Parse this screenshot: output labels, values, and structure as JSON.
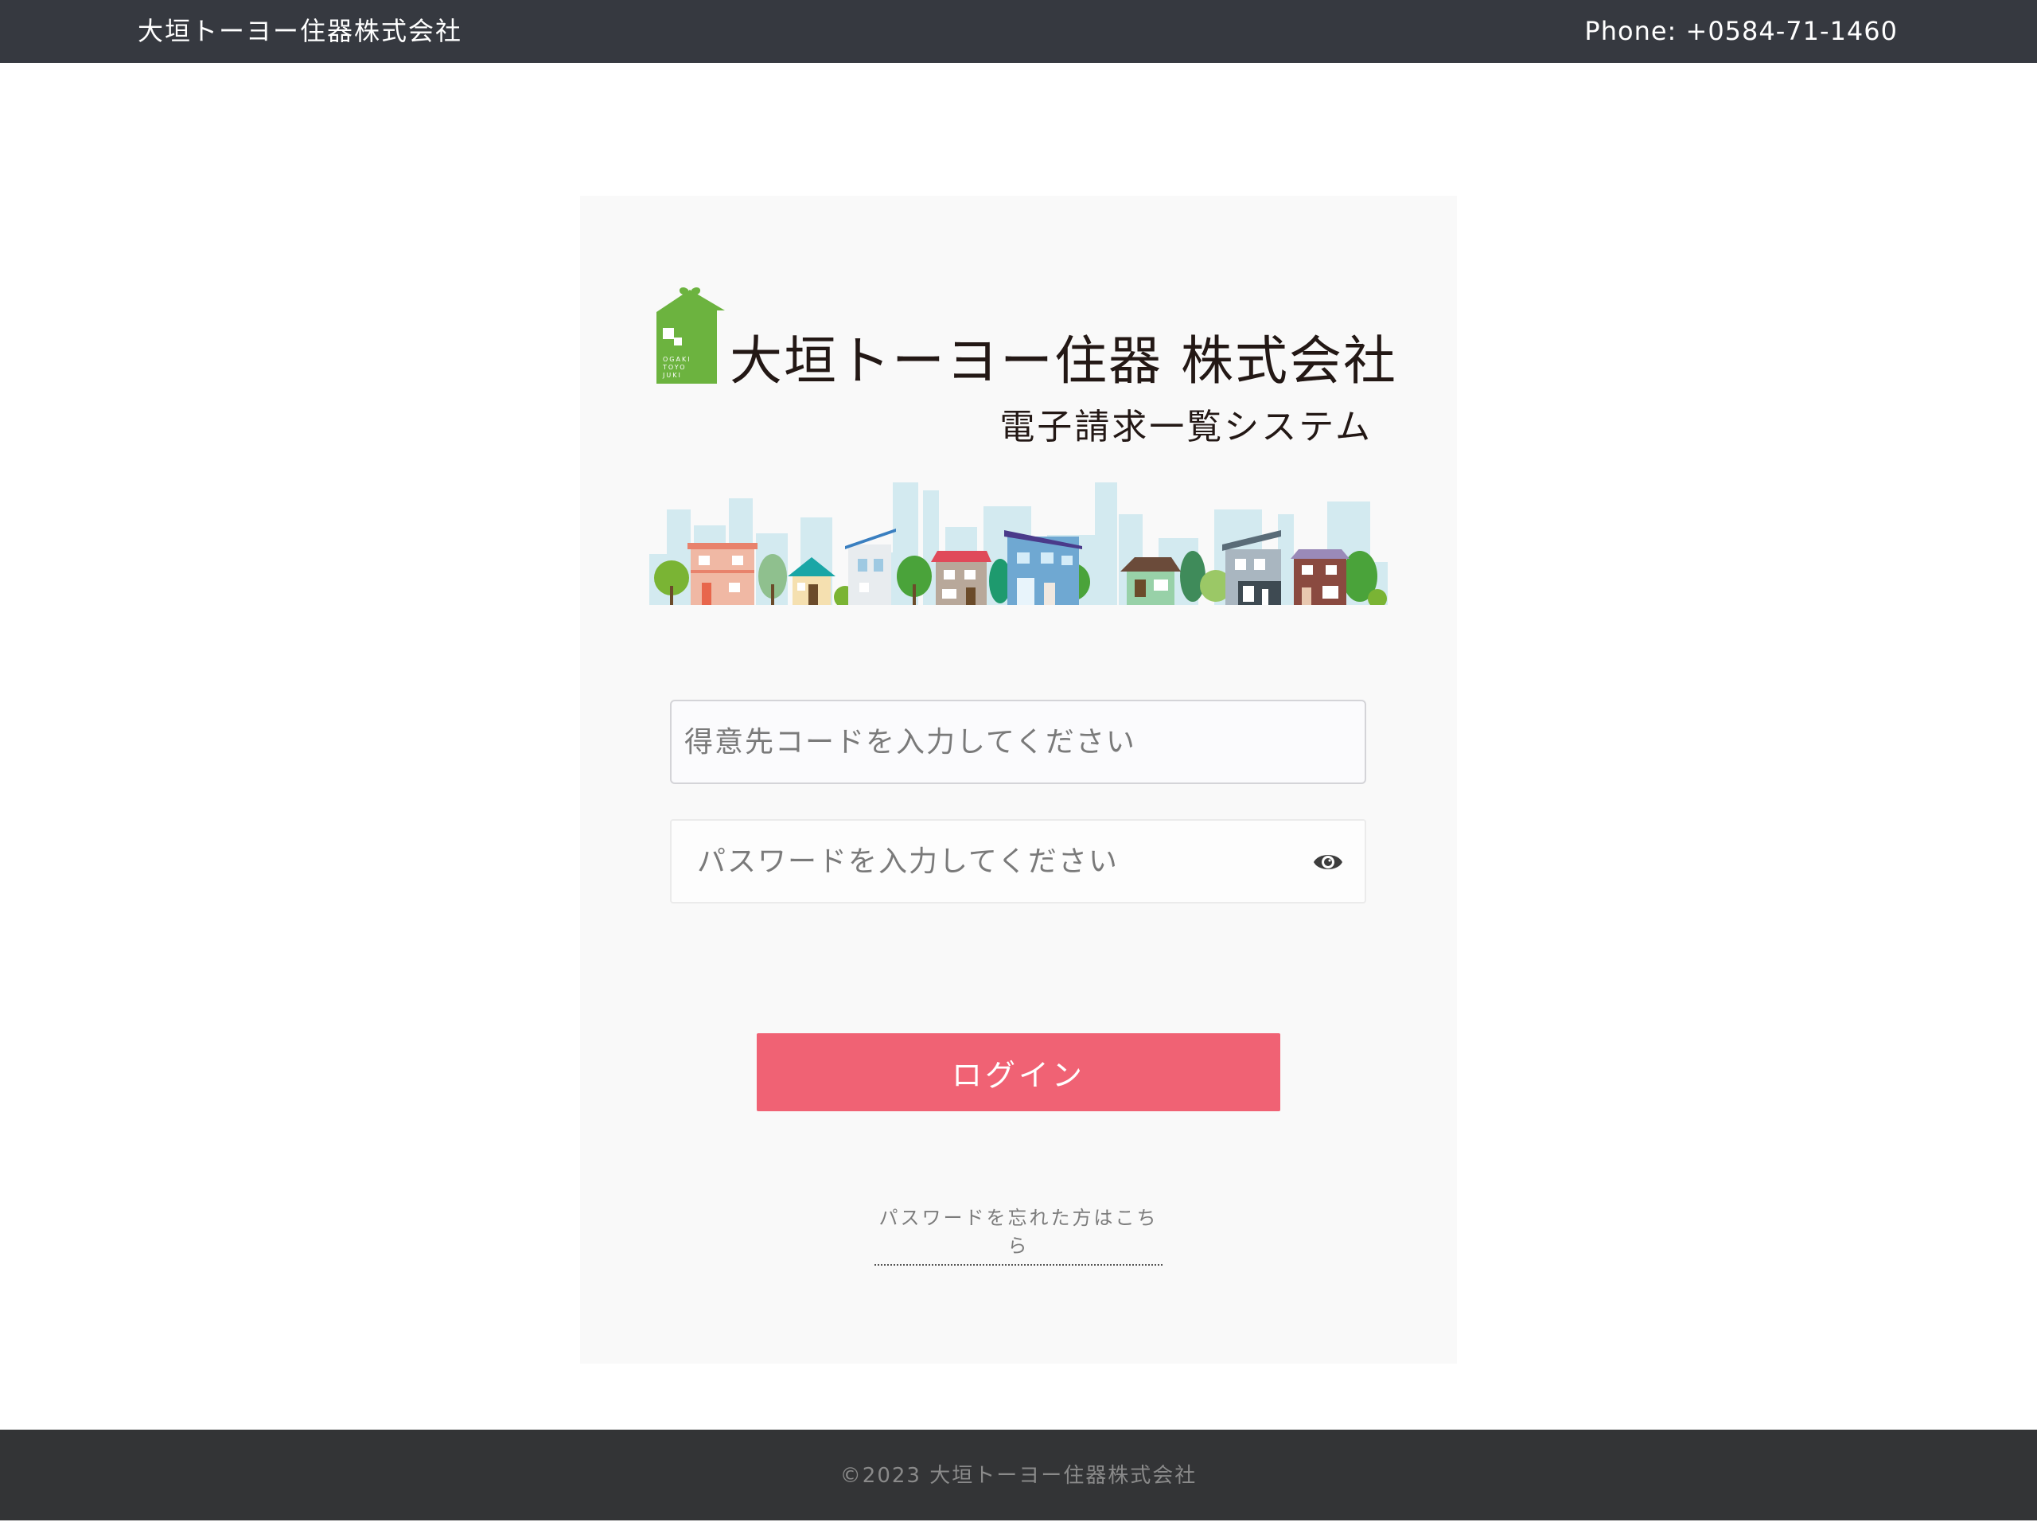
{
  "header": {
    "brand": "大垣トーヨー住器株式会社",
    "phone": "Phone: +0584-71-1460"
  },
  "logo": {
    "company": "大垣トーヨー住器 株式会社",
    "system": "電子請求一覧システム",
    "mark_text": [
      "OGAKI",
      "TOYO",
      "JUKI"
    ],
    "brand_color": "#6cb33f"
  },
  "form": {
    "customer_code_placeholder": "得意先コードを入力してください",
    "customer_code_value": "",
    "password_placeholder": "パスワードを入力してください",
    "password_value": "",
    "login_label": "ログイン",
    "forgot_label": "パスワードを忘れた方はこちら",
    "toggle_icon": "eye-icon"
  },
  "colors": {
    "header_bg": "#363940",
    "footer_bg": "#333436",
    "login_bg": "#f06274",
    "card_bg": "#f9f9f9"
  },
  "footer": {
    "copyright": "©2023 大垣トーヨー住器株式会社"
  }
}
